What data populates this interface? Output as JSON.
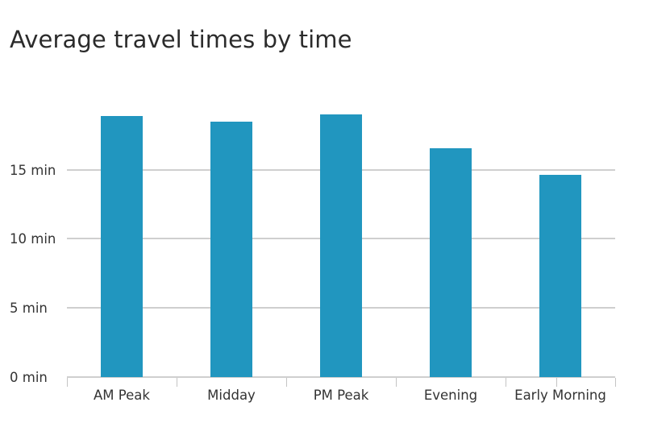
{
  "chart_data": {
    "type": "bar",
    "title": "Average travel times by time",
    "xlabel": "",
    "ylabel": "",
    "categories": [
      "AM Peak",
      "Midday",
      "PM Peak",
      "Evening",
      "Early Morning"
    ],
    "values": [
      18.9,
      18.5,
      19.0,
      16.6,
      14.65
    ],
    "unit": "min",
    "ytick_values": [
      0,
      5,
      10,
      15
    ],
    "ytick_labels": [
      "0 min",
      "5 min",
      "10 min",
      "15 min"
    ],
    "ylim": [
      0,
      20
    ],
    "grid": "horizontal",
    "legend": "none",
    "bar_color": "#2196bf",
    "gridline_color": "#cfcfcf",
    "text_color": "#333333",
    "title_color": "#2b2b2b",
    "background": "#ffffff"
  }
}
